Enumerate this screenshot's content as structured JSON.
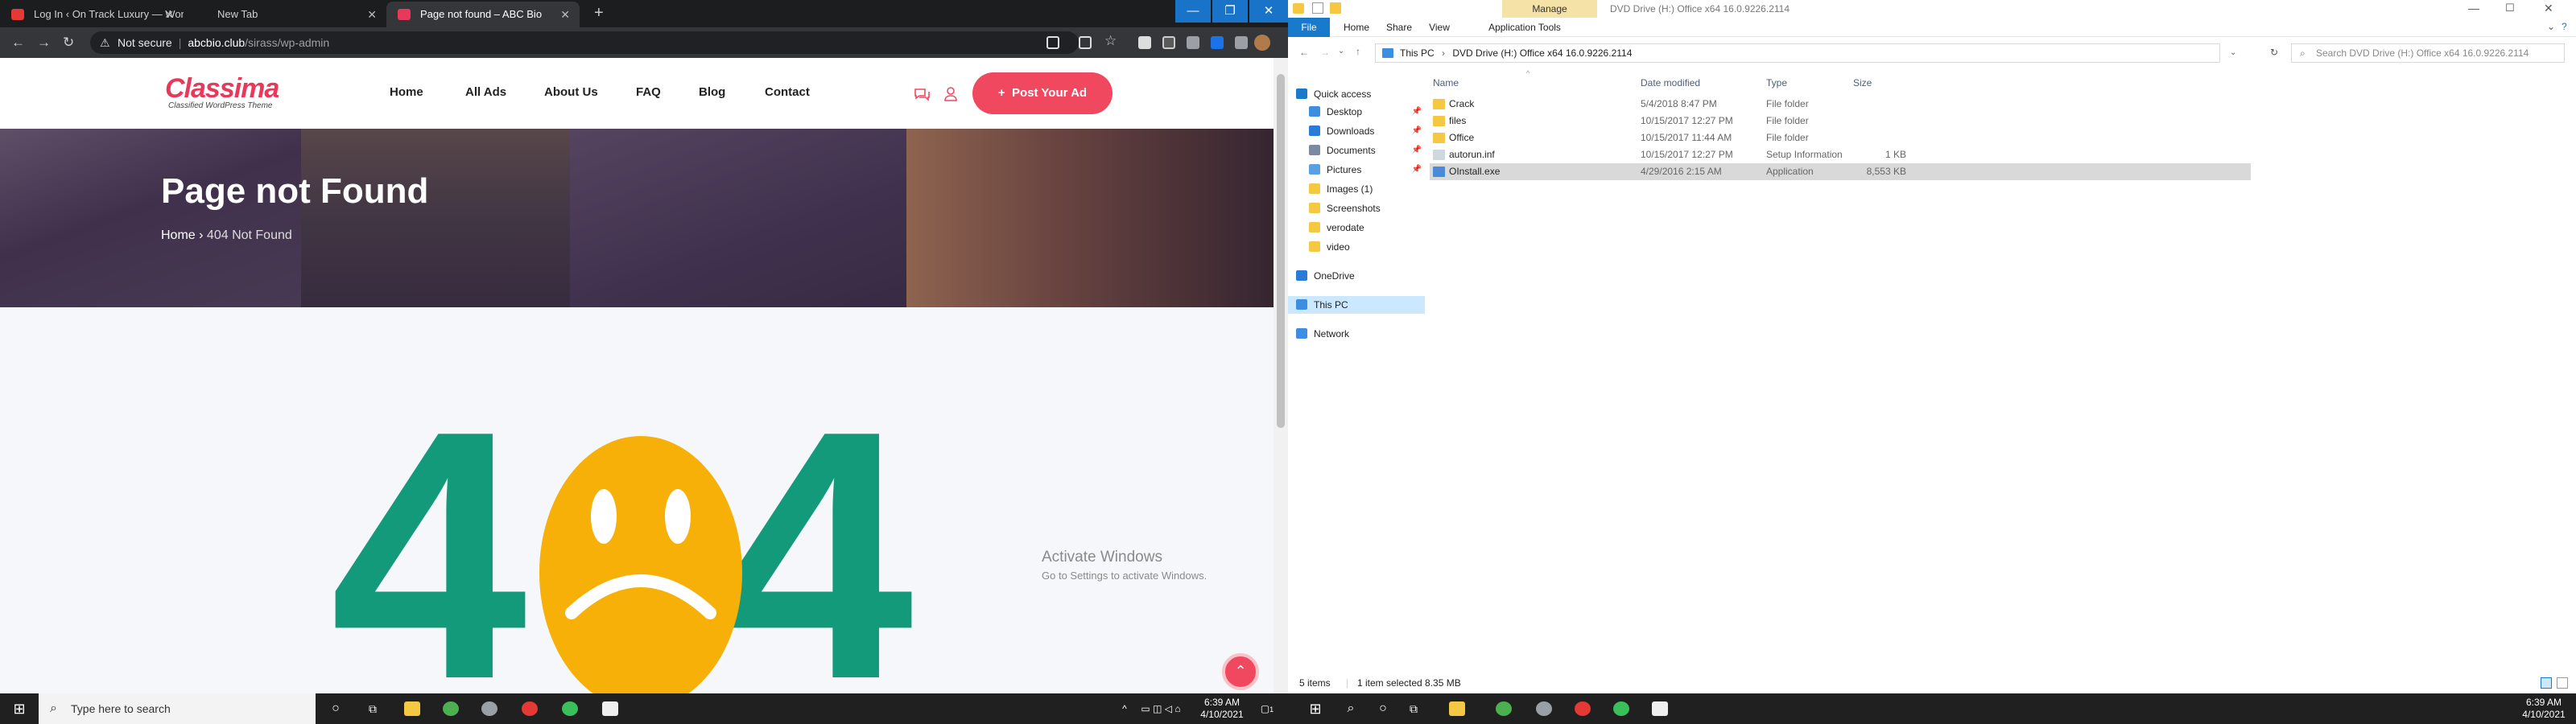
{
  "browser": {
    "tabs": [
      {
        "title": "Log In ‹ On Track Luxury — WordPress",
        "favicon_color": "#e53935"
      },
      {
        "title": "New Tab",
        "favicon_color": "#5f6368"
      },
      {
        "title": "Page not found – ABC Bio",
        "favicon_color": "#e8395a"
      }
    ],
    "new_tab_symbol": "+",
    "address": {
      "security": "Not secure",
      "host": "abcbio.club",
      "path": "/sirass/wp-admin"
    }
  },
  "site": {
    "logo": "Classima",
    "logo_sub": "Classified WordPress Theme",
    "menu": [
      "Home",
      "All Ads",
      "About Us",
      "FAQ",
      "Blog",
      "Contact"
    ],
    "post_ad": "Post Your Ad",
    "post_ad_icon": "+",
    "hero_title": "Page not Found",
    "breadcrumb_home": "Home",
    "breadcrumb_sep": "›",
    "breadcrumb_current": "404 Not Found",
    "error_left": "4",
    "error_right": "4",
    "brand_color": "#f0485f",
    "teal": "#139a7a",
    "yellow": "#f7b008"
  },
  "activate": {
    "line1": "Activate Windows",
    "line2": "Go to Settings to activate Windows."
  },
  "explorer": {
    "manage": "Manage",
    "title": "DVD Drive (H:) Office x64 16.0.9226.2114",
    "ribbon_tabs": [
      "File",
      "Home",
      "Share",
      "View",
      "Application Tools"
    ],
    "path": [
      "This PC",
      "DVD Drive (H:) Office x64 16.0.9226.2114"
    ],
    "search_placeholder": "Search DVD Drive (H:) Office x64 16.0.9226.2114",
    "nav": [
      {
        "label": "Quick access",
        "icon": "star-icon",
        "color": "#1979ca"
      },
      {
        "label": "Desktop",
        "icon": "desktop-icon",
        "color": "#3d8ee0",
        "pinned": true
      },
      {
        "label": "Downloads",
        "icon": "download-icon",
        "color": "#2a7bd6",
        "pinned": true
      },
      {
        "label": "Documents",
        "icon": "documents-icon",
        "color": "#7a8aa0",
        "pinned": true
      },
      {
        "label": "Pictures",
        "icon": "pictures-icon",
        "color": "#5aa0e0",
        "pinned": true
      },
      {
        "label": "Images (1)",
        "icon": "folder-icon",
        "color": "#f4c842"
      },
      {
        "label": "Screenshots",
        "icon": "folder-icon",
        "color": "#f4c842"
      },
      {
        "label": "verodate",
        "icon": "folder-icon",
        "color": "#f4c842"
      },
      {
        "label": "video",
        "icon": "folder-icon",
        "color": "#f4c842"
      },
      {
        "label": "OneDrive",
        "icon": "cloud-icon",
        "color": "#2a7bd6"
      },
      {
        "label": "This PC",
        "icon": "computer-icon",
        "color": "#3d8ee0"
      },
      {
        "label": "Network",
        "icon": "network-icon",
        "color": "#3d8ee0"
      }
    ],
    "pin_symbol": "📌",
    "columns": [
      "Name",
      "Date modified",
      "Type",
      "Size"
    ],
    "files": [
      {
        "name": "Crack",
        "date": "5/4/2018 8:47 PM",
        "type": "File folder",
        "size": "",
        "icon": "folder-icon"
      },
      {
        "name": "files",
        "date": "10/15/2017 12:27 PM",
        "type": "File folder",
        "size": "",
        "icon": "folder-icon"
      },
      {
        "name": "Office",
        "date": "10/15/2017 11:44 AM",
        "type": "File folder",
        "size": "",
        "icon": "folder-icon"
      },
      {
        "name": "autorun.inf",
        "date": "10/15/2017 12:27 PM",
        "type": "Setup Information",
        "size": "1 KB",
        "icon": "settings-file-icon"
      },
      {
        "name": "OInstall.exe",
        "date": "4/29/2016 2:15 AM",
        "type": "Application",
        "size": "8,553 KB",
        "icon": "exe-icon",
        "selected": true
      }
    ],
    "status_items": "5 items",
    "status_selected": "1 item selected  8.35 MB"
  },
  "taskbar": {
    "search_placeholder": "Type here to search",
    "time": "6:39 AM",
    "date": "4/10/2021",
    "notif_count": "1"
  }
}
